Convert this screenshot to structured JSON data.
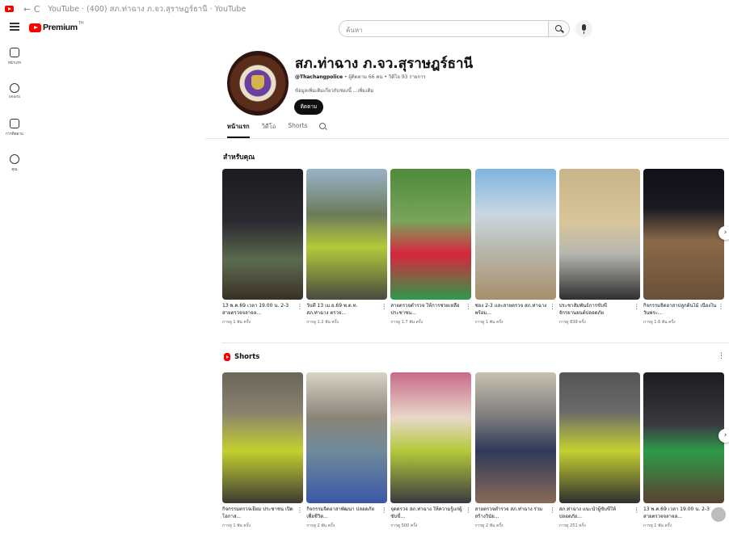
{
  "browser": {
    "tab_title": "YouTube · (400) สภ.ท่าฉาง ภ.จว.สุราษฎร์ธานี · YouTube",
    "nav_glyphs": "←  C"
  },
  "header": {
    "logo_text": "Premium",
    "logo_superscript": "TH",
    "search_placeholder": "ค้นหา"
  },
  "guide": {
    "items": [
      {
        "label": "หน้าแรก",
        "icon": "home-icon"
      },
      {
        "label": "Shorts",
        "icon": "shorts-icon"
      },
      {
        "label": "การติดตาม",
        "icon": "subscriptions-icon"
      },
      {
        "label": "คุณ",
        "icon": "you-icon"
      }
    ]
  },
  "channel": {
    "name": "สภ.ท่าฉาง ภ.จว.สุราษฎร์ธานี",
    "handle": "@Thachangpolice",
    "meta": "• ผู้ติดตาม 66 คน • วิดีโอ 93 รายการ",
    "description": "ข้อมูลเพิ่มเติมเกี่ยวกับช่องนี้ ...เพิ่มเติม",
    "subscribe_label": "ติดตาม"
  },
  "tabs": [
    {
      "label": "หน้าแรก",
      "active": true
    },
    {
      "label": "วิดีโอ",
      "active": false
    },
    {
      "label": "Shorts",
      "active": false
    }
  ],
  "sections": {
    "for_you_title": "สำหรับคุณ",
    "shorts_title": "Shorts",
    "more_glyph": "⋮"
  },
  "for_you": [
    {
      "title": "13 พ.ค.69 เวลา 19.00 น. 2-3 สายตรวจจลาจล...",
      "views": "การดู 1 พัน ครั้ง"
    },
    {
      "title": "วันที่ 13 เม.ย.69 พ.ต.ท. สภ.ท่าฉาง ตรวจ...",
      "views": "การดู 1.2 พัน ครั้ง"
    },
    {
      "title": "สายตรวจตำรวจ ให้การช่วยเหลือประชาชน...",
      "views": "การดู 1.7 พัน ครั้ง"
    },
    {
      "title": "ช่อง 2-3 และสายตรวจ สภ.ท่าฉาง พร้อม...",
      "views": "การดู 1 พัน ครั้ง"
    },
    {
      "title": "ประชาสัมพันธ์การขับขี่จักรยานยนต์ปลอดภัย",
      "views": "การดู 839 ครั้ง"
    },
    {
      "title": "กิจกรรมจิตอาสาปลูกต้นไม้ เนื่องในวันพระ...",
      "views": "การดู 1.6 พัน ครั้ง"
    }
  ],
  "shorts": [
    {
      "title": "กิจกรรมตรวจเยี่ยม ประชาชน เปิดโอกาส...",
      "views": "การดู 1 พัน ครั้ง"
    },
    {
      "title": "กิจกรรมจิตอาสาพัฒนา ปลอดภัยเพื่อชีวิต...",
      "views": "การดู 2 พัน ครั้ง"
    },
    {
      "title": "จุดตรวจ สภ.ท่าฉาง ให้ความรู้แก่ผู้ขับขี่...",
      "views": "การดู 500 ครั้ง"
    },
    {
      "title": "สายตรวจตำรวจ สภ.ท่าฉาง ร่วมสร้างวินัย...",
      "views": "การดู 2 พัน ครั้ง"
    },
    {
      "title": "สภ.ท่าฉาง แนะนำผู้ขับขี่ให้ปลอดภัย...",
      "views": "การดู 251 ครั้ง"
    },
    {
      "title": "13 พ.ค.69 เวลา 19.00 น. 2-3 สายตรวจจลาจล...",
      "views": "การดู 1 พัน ครั้ง"
    }
  ],
  "colors": {
    "accent": "#ff0000",
    "text": "#0f0f0f",
    "muted": "#606060",
    "subscribe_bg": "#0f0f0f"
  }
}
